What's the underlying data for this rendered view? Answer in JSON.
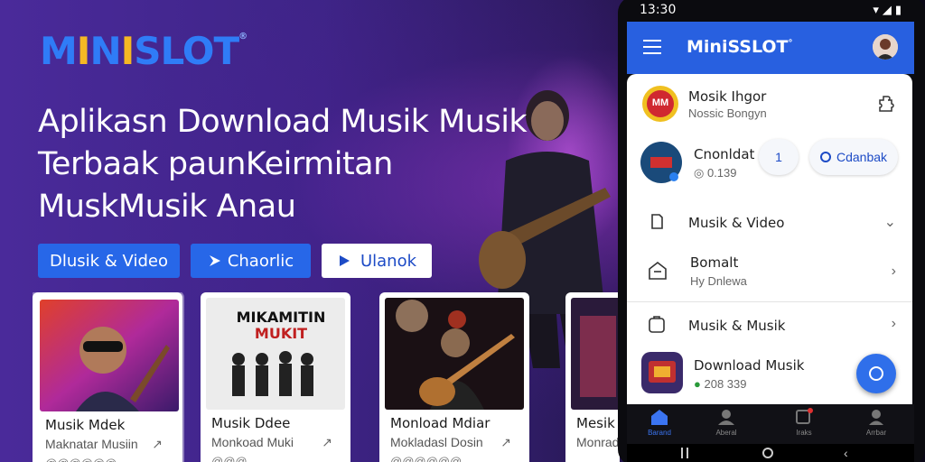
{
  "brand": {
    "m": "M",
    "i1": "I",
    "n": "N",
    "i2": "I",
    "rest": "SLOT",
    "reg": "®"
  },
  "headline": {
    "line1": "Aplikasn Download Musik Musik",
    "line2": "Terbaak paunKeirmitan",
    "line3": "MuskMusik Anau"
  },
  "cta": {
    "music_video": "Dlusik & Video",
    "favorite": "Chaorlic",
    "play": "Ulanok"
  },
  "cards": [
    {
      "title": "Musik Mdek",
      "subtitle": "Maknatar Musiin",
      "meta": "@@@@@@"
    },
    {
      "title": "Musik Ddee",
      "subtitle": "Monkoad Muki",
      "meta": "@@@",
      "poster_title": "MIKAMITIN",
      "poster_sub": "MUKIT"
    },
    {
      "title": "Monload Mdiar",
      "subtitle": "Mokladasl Dosin",
      "meta": "@@@@@@"
    },
    {
      "title": "Mesik",
      "subtitle": "Monrad",
      "meta": ""
    }
  ],
  "phone": {
    "status_time": "13:30",
    "status_icons": "▾◢▮",
    "app_title": "MiniSSLOT",
    "app_title_reg": "°",
    "top_item": {
      "title": "Mosik Ihgor",
      "subtitle": "Nossic Bongyn",
      "logo_text": "MM"
    },
    "second_item": {
      "title": "Cnonldat",
      "subtitle": "0.139",
      "pill_1": "1",
      "pill_2": "Cdanbak"
    },
    "menu": [
      {
        "label": "Musik & Video",
        "sub": ""
      },
      {
        "label": "Bomalt",
        "sub": "Hy Dnlewa"
      },
      {
        "label": "Musik & Musik",
        "sub": ""
      }
    ],
    "bottom_item": {
      "title": "Download Musik",
      "subtitle": "208 339"
    },
    "nav": [
      {
        "label": "Barand"
      },
      {
        "label": "Aberal"
      },
      {
        "label": "Iraks"
      },
      {
        "label": "Arrbar"
      }
    ]
  },
  "colors": {
    "accent": "#2860e0",
    "brand_blue": "#2f7cf7",
    "brand_yellow": "#f5b823"
  }
}
